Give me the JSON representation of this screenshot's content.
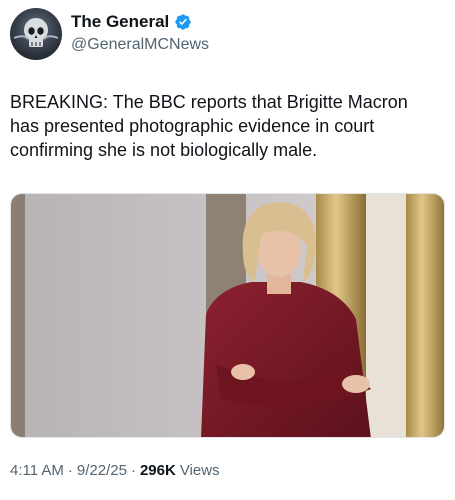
{
  "author": {
    "display_name": "The General",
    "handle": "@GeneralMCNews",
    "verified": true,
    "avatar_icon": "skull-logo-avatar"
  },
  "tweet": {
    "lines": [
      "BREAKING: The BBC reports that Brigitte Macron",
      "has presented photographic evidence in court",
      "confirming she is not biologically male."
    ]
  },
  "media": {
    "subject": "photo-woman-in-burgundy-jacket"
  },
  "meta": {
    "time": "4:11 AM",
    "date": "9/22/25",
    "views_count": "296K",
    "views_label": "Views",
    "separator": "·"
  },
  "colors": {
    "text_primary": "#0f1419",
    "text_secondary": "#536471",
    "verified_blue": "#1d9bf0",
    "jacket": "#7a1a24"
  }
}
